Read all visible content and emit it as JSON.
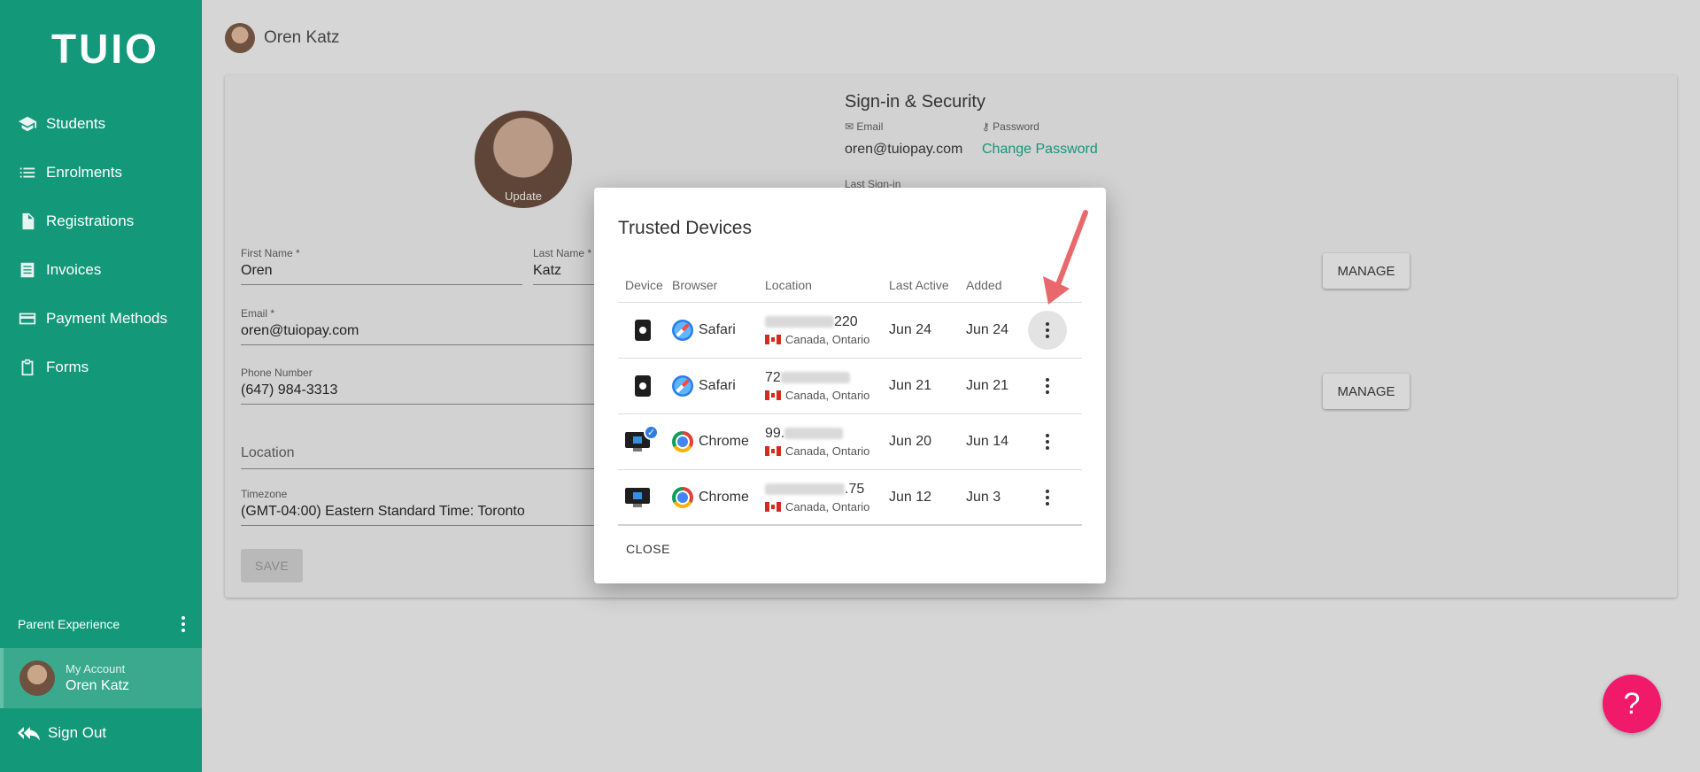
{
  "app": {
    "logo": "TUIO"
  },
  "sidebar": {
    "items": [
      {
        "label": "Students",
        "icon": "graduation-cap-icon"
      },
      {
        "label": "Enrolments",
        "icon": "list-icon"
      },
      {
        "label": "Registrations",
        "icon": "document-icon"
      },
      {
        "label": "Invoices",
        "icon": "invoice-icon"
      },
      {
        "label": "Payment Methods",
        "icon": "credit-card-icon"
      },
      {
        "label": "Forms",
        "icon": "clipboard-icon"
      }
    ],
    "section_label": "Parent Experience",
    "account": {
      "label": "My Account",
      "name": "Oren Katz"
    },
    "sign_out": "Sign Out"
  },
  "header": {
    "user_name": "Oren Katz"
  },
  "profile": {
    "avatar_label": "Update",
    "first_name": {
      "label": "First Name *",
      "value": "Oren"
    },
    "last_name": {
      "label": "Last Name *",
      "value": "Katz"
    },
    "email": {
      "label": "Email *",
      "value": "oren@tuiopay.com"
    },
    "phone": {
      "label": "Phone Number",
      "value": "(647) 984-3313"
    },
    "location": {
      "placeholder": "Location"
    },
    "timezone": {
      "label": "Timezone",
      "value": "(GMT-04:00) Eastern Standard Time: Toronto"
    },
    "save_label": "SAVE"
  },
  "security": {
    "title": "Sign-in & Security",
    "email_label": "Email",
    "email_value": "oren@tuiopay.com",
    "password_label": "Password",
    "change_password": "Change Password",
    "last_signin_label": "Last Sign-in",
    "manage_label": "MANAGE"
  },
  "dialog": {
    "title": "Trusted Devices",
    "columns": [
      "Device",
      "Browser",
      "Location",
      "Last Active",
      "Added"
    ],
    "rows": [
      {
        "device": "phone",
        "browser": "Safari",
        "ip_visible": "220",
        "location": "Canada, Ontario",
        "last_active": "Jun 24",
        "added": "Jun 24",
        "current": false
      },
      {
        "device": "phone",
        "browser": "Safari",
        "ip_visible": "72",
        "location": "Canada, Ontario",
        "last_active": "Jun 21",
        "added": "Jun 21",
        "current": false
      },
      {
        "device": "desktop",
        "browser": "Chrome",
        "ip_visible": "99.",
        "location": "Canada, Ontario",
        "last_active": "Jun 20",
        "added": "Jun 14",
        "current": true
      },
      {
        "device": "desktop",
        "browser": "Chrome",
        "ip_visible": ".75",
        "location": "Canada, Ontario",
        "last_active": "Jun 12",
        "added": "Jun 3",
        "current": false
      }
    ],
    "close_label": "CLOSE"
  },
  "help": {
    "label": "?"
  },
  "colors": {
    "brand": "#14987a",
    "help": "#f0196a",
    "arrow": "#e8686b"
  }
}
